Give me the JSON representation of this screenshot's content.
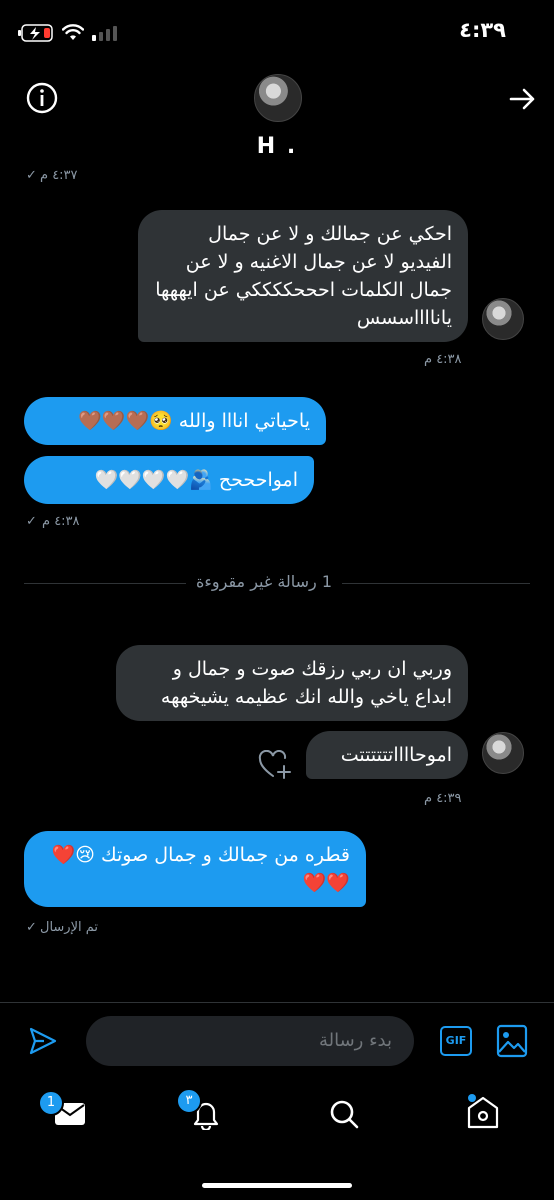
{
  "status_bar": {
    "time": "٤:٣٩"
  },
  "header": {
    "title": "H ."
  },
  "messages": {
    "top_time": "٤:٣٧ م",
    "m1_text": "احكي عن جمالك و لا عن جمال الفيديو لا عن جمال الاغنيه و لا عن جمال الكلمات احححككككي عن ايههها يانااااسسس",
    "m1_time": "٤:٣٨ م",
    "m2_text": "ياحياتي انااا والله 🥺🤎🤎🤎",
    "m3_text": "امواحححح 🫂🤍🤍🤍🤍",
    "m3_time": "٤:٣٨ م",
    "divider": "1 رسالة غير مقروءة",
    "m4_text": "وربي ان ربي رزقك صوت و جمال و ابداع ياخي والله انك عظيمه يشيخههه",
    "m5_text": "اموحااااتتتتتتت",
    "m5_time": "٤:٣٩ م",
    "m6_text": "قطره من جمالك و جمال صوتك 😢❤️❤️❤️",
    "m6_status": "تم الإرسال"
  },
  "composer": {
    "placeholder": "بدء رسالة",
    "gif_label": "GIF"
  },
  "tabbar": {
    "messages_badge": "1",
    "notifications_badge": "٣"
  },
  "colors": {
    "accent": "#1d9bf0",
    "bubble_gray": "#2f3336",
    "background": "#000000"
  }
}
